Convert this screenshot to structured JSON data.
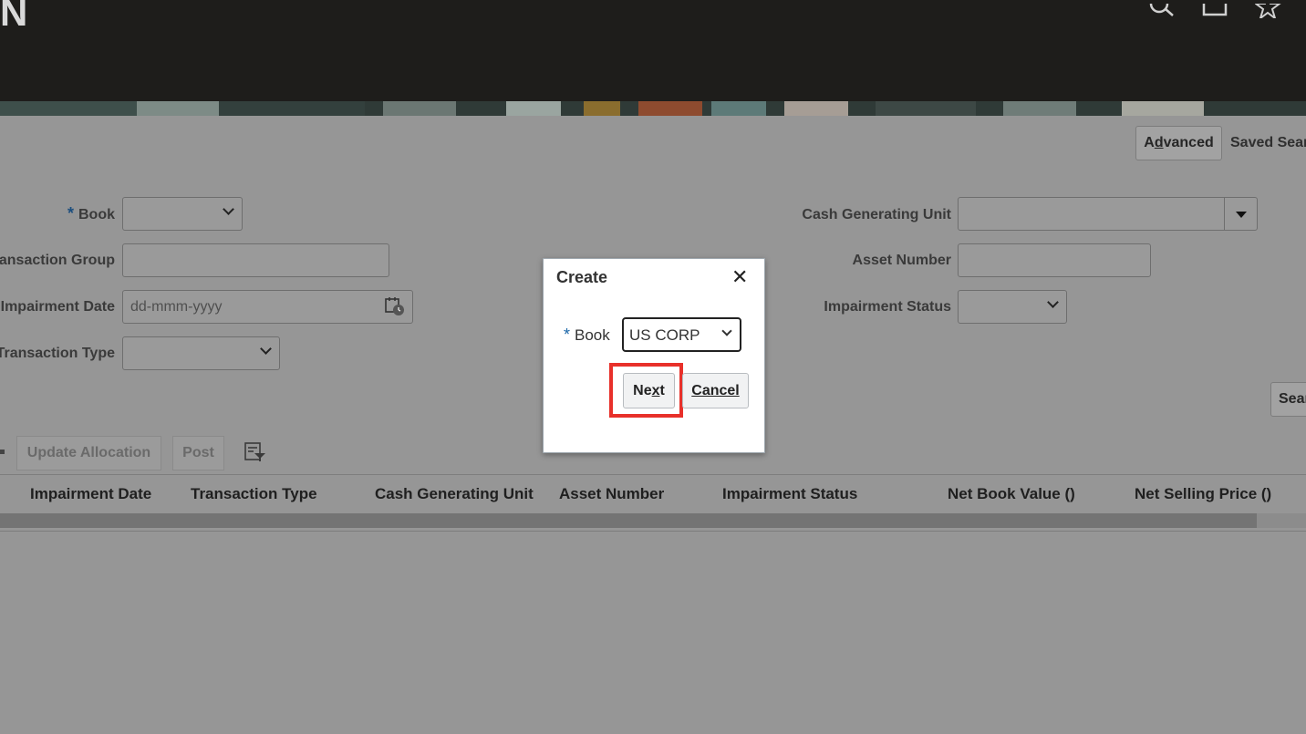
{
  "header": {
    "brand": "N",
    "icons": [
      "search-icon",
      "window-icon",
      "favorite-star-icon"
    ]
  },
  "search": {
    "advanced_label": "Advanced",
    "saved_search_label": "Saved Sear",
    "search_button_label": "Sear",
    "fields": {
      "book_label": "Book",
      "transaction_group_label": "ansaction Group",
      "impairment_date_label": "Impairment Date",
      "impairment_date_placeholder": "dd-mmm-yyyy",
      "transaction_type_label": "Transaction Type",
      "cash_generating_unit_label": "Cash Generating Unit",
      "asset_number_label": "Asset Number",
      "impairment_status_label": "Impairment Status"
    }
  },
  "toolbar": {
    "update_allocation_label": "Update Allocation",
    "post_label": "Post"
  },
  "table": {
    "columns": [
      "Impairment Date",
      "Transaction Type",
      "Cash Generating Unit",
      "Asset Number",
      "Impairment Status",
      "Net Book Value ()",
      "Net Selling Price ()"
    ]
  },
  "dialog": {
    "title": "Create",
    "book_label": "Book",
    "book_value": "US CORP",
    "next_label": "Next",
    "cancel_label": "Cancel"
  },
  "colors": {
    "header_bg": "#1e1d1b",
    "highlight": "#e8302a",
    "required": "#1a66a8"
  }
}
